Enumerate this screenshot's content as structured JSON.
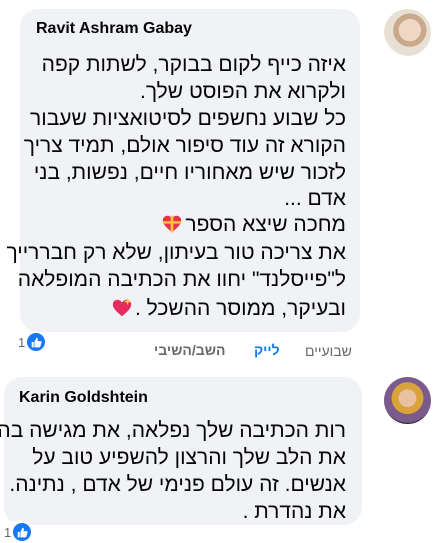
{
  "comments": [
    {
      "author": "Ravit Ashram Gabay",
      "lines": [
        "איזה כייף לקום בבוקר, לשתות קפה",
        "ולקרוא את הפוסט שלך.",
        "כל שבוע נחשפים לסיטואציות שעבור",
        "הקורא זה עוד סיפור אולם, תמיד צריך",
        "לזכור שיש מאחוריו חיים, נפשות, בני",
        "אדם ..."
      ],
      "line_gift": "מחכה שיצא הספר",
      "lines_b": [
        "את צריכה טור בעיתון, שלא רק חבררייך",
        "ל\"פייסלנד\" יחוו את הכתיבה המופלאה"
      ],
      "line_last": "ובעיקר, ממוסר ההשכל .",
      "reaction_count": "1",
      "time": "שבועיים",
      "like_label": "לייק",
      "reply_label": "השב/השיבי"
    },
    {
      "author": "Karin Goldshtein",
      "lines": [
        "רות הכתיבה שלך נפלאה, את מגישה בה",
        "את הלב שלך והרצון להשפיע טוב על",
        "אנשים. זה עולם פנימי של אדם , נתינה.",
        "את נהדרת ."
      ],
      "reaction_count": "1"
    }
  ],
  "colors": {
    "bubble": "#f0f2f5",
    "link": "#1877f2",
    "muted": "#65676b",
    "gift_heart": "#e8324a"
  },
  "icons": [
    "gift-heart-icon",
    "sparkling-heart-icon",
    "like-icon"
  ]
}
